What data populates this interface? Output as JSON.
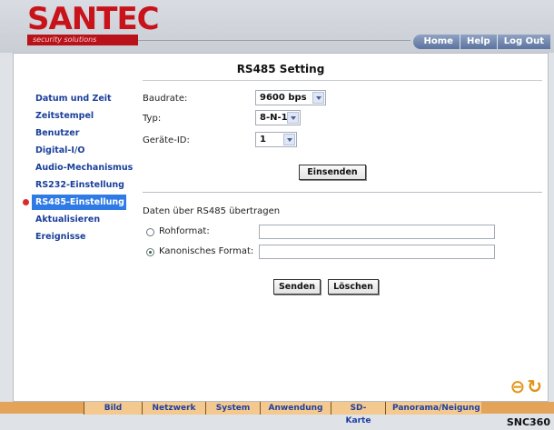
{
  "header": {
    "logo": "SANTEC",
    "logo_sub": "security solutions",
    "top_nav": [
      "Home",
      "Help",
      "Log Out"
    ]
  },
  "title": "RS485 Setting",
  "sidebar": {
    "items": [
      {
        "label": "Datum und Zeit"
      },
      {
        "label": "Zeitstempel"
      },
      {
        "label": "Benutzer"
      },
      {
        "label": "Digital-I/O"
      },
      {
        "label": "Audio-Mechanismus"
      },
      {
        "label": "RS232-Einstellung"
      },
      {
        "label": "RS485-Einstellung"
      },
      {
        "label": "Aktualisieren"
      },
      {
        "label": "Ereignisse"
      }
    ],
    "active": "RS485-Einstellung"
  },
  "settings": {
    "baudrate_label": "Baudrate:",
    "baudrate_value": "9600 bps",
    "type_label": "Typ:",
    "type_value": "8-N-1",
    "device_id_label": "Geräte-ID:",
    "device_id_value": "1",
    "submit_label": "Einsenden"
  },
  "transfer": {
    "section_label": "Daten über RS485 übertragen",
    "raw_label": "Rohformat:",
    "raw_value": "",
    "canonical_label": "Kanonisches Format:",
    "canonical_value": "",
    "selected": "canonical",
    "send_label": "Senden",
    "clear_label": "Löschen"
  },
  "bottom_nav": [
    "Bild",
    "Netzwerk",
    "System",
    "Anwendung",
    "SD-Karte",
    "Panorama/Neigung"
  ],
  "footer": "SNC360",
  "colors": {
    "accent": "#2f7be6",
    "brand_red": "#c8131b",
    "link_blue": "#1a3f9b",
    "bottom_bar": "#e3a45a",
    "ptz_icon": "#e09314"
  }
}
